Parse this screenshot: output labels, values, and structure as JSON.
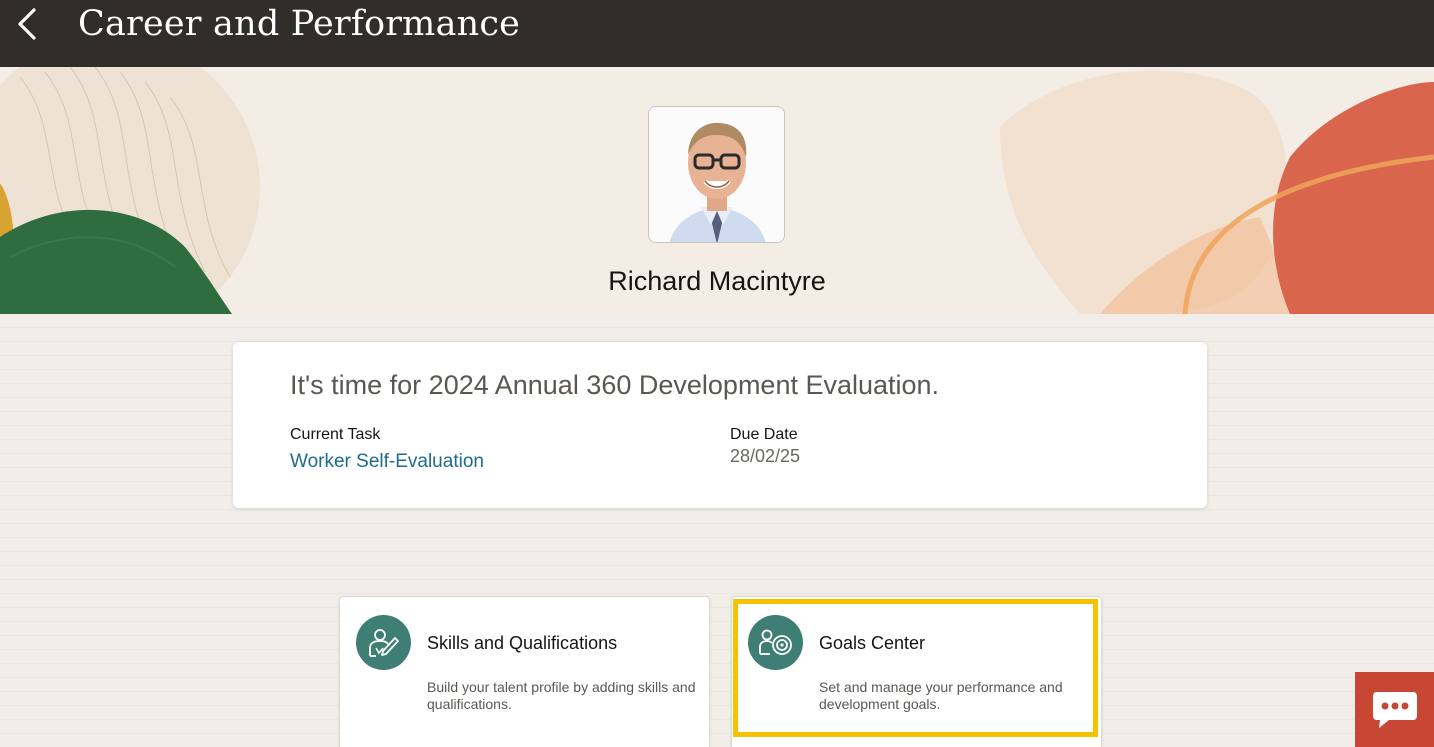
{
  "header": {
    "title": "Career and Performance",
    "back_icon": "chevron-left-icon"
  },
  "profile": {
    "name": "Richard Macintyre"
  },
  "evaluation": {
    "heading": "It's time for 2024 Annual 360 Development Evaluation.",
    "current_task_label": "Current Task",
    "current_task_link": "Worker Self-Evaluation",
    "due_date_label": "Due Date",
    "due_date_value": "28/02/25"
  },
  "tiles": [
    {
      "title": "Skills and Qualifications",
      "description": "Build your talent profile by adding skills and qualifications.",
      "icon": "person-edit-icon"
    },
    {
      "title": "Goals Center",
      "description": "Set and manage your performance and development goals.",
      "icon": "person-target-icon"
    }
  ],
  "colors": {
    "header_bg": "#312d2a",
    "accent_teal": "#3f7e74",
    "link": "#1f6b8c",
    "highlight": "#f6c200",
    "chat_bg": "#c74634"
  },
  "chat": {
    "icon": "chat-bubble-icon"
  }
}
